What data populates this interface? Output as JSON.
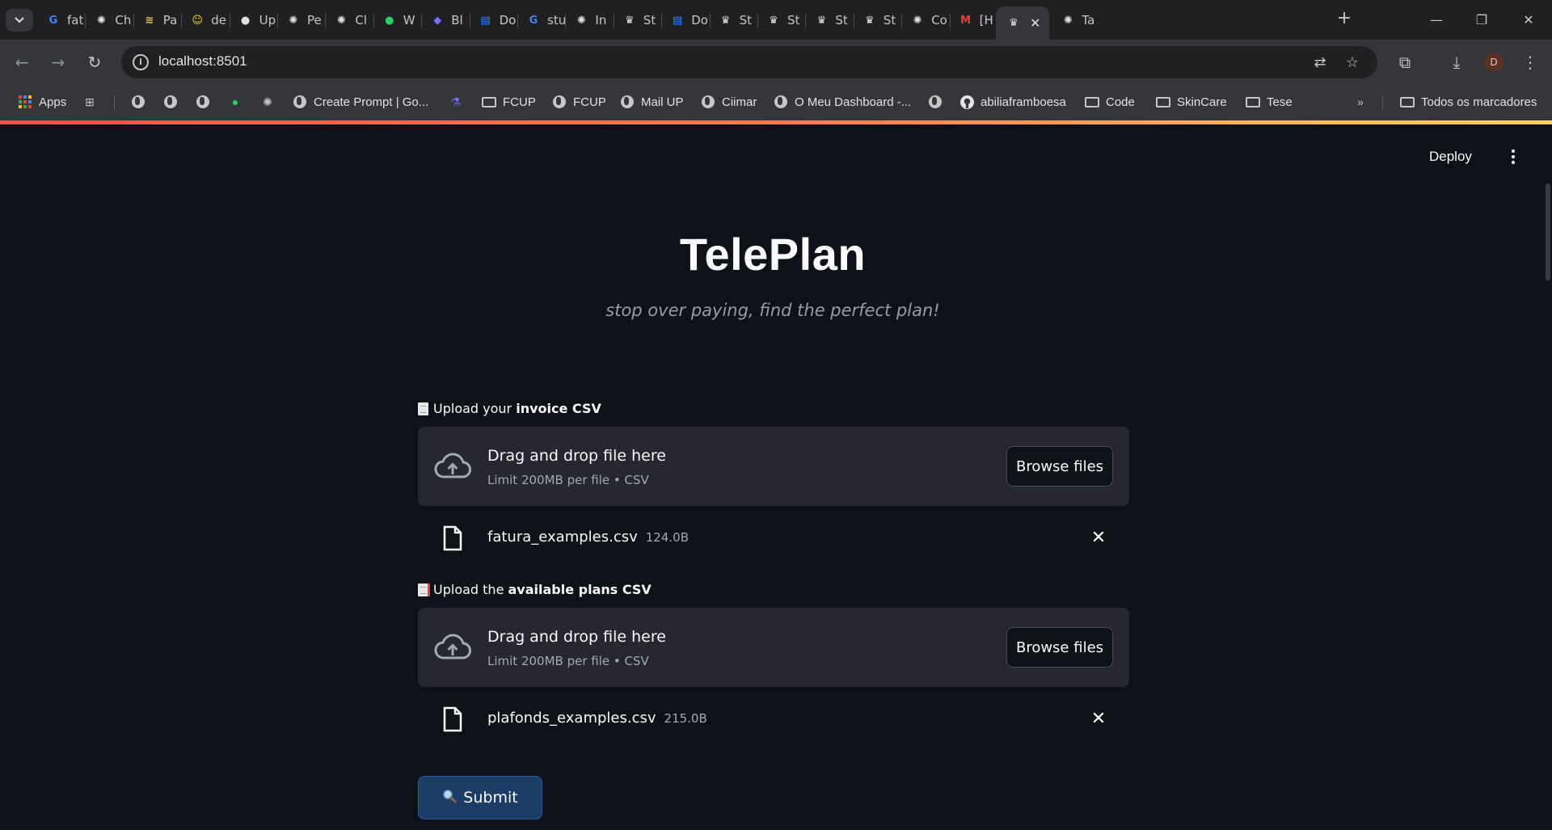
{
  "browser": {
    "tabs": [
      {
        "title": "fat",
        "icon": "google-icon"
      },
      {
        "title": "Ch",
        "icon": "openai-icon"
      },
      {
        "title": "Pa",
        "icon": "papers-icon"
      },
      {
        "title": "de",
        "icon": "huggingface-icon"
      },
      {
        "title": "Up",
        "icon": "github-icon"
      },
      {
        "title": "Pe",
        "icon": "openai-icon"
      },
      {
        "title": "Cl",
        "icon": "openai-icon"
      },
      {
        "title": "W",
        "icon": "whatsapp-icon"
      },
      {
        "title": "Bl",
        "icon": "shield-icon"
      },
      {
        "title": "Do",
        "icon": "docs-icon"
      },
      {
        "title": "stu",
        "icon": "google-icon"
      },
      {
        "title": "In",
        "icon": "openai-icon"
      },
      {
        "title": "St",
        "icon": "streamlit-icon"
      },
      {
        "title": "Do",
        "icon": "docs-icon"
      },
      {
        "title": "St",
        "icon": "streamlit-icon"
      },
      {
        "title": "St",
        "icon": "streamlit-icon"
      },
      {
        "title": "St",
        "icon": "streamlit-icon"
      },
      {
        "title": "St",
        "icon": "streamlit-icon"
      },
      {
        "title": "Co",
        "icon": "openai-icon"
      },
      {
        "title": "[H",
        "icon": "gmail-icon"
      },
      {
        "title": "",
        "icon": "streamlit-icon",
        "active": true
      },
      {
        "title": "Ta",
        "icon": "openai-icon"
      }
    ],
    "url": "localhost:8501",
    "avatar_letter": "D",
    "bookmarks": {
      "apps": "Apps",
      "create_prompt": "Create Prompt | Go...",
      "fcup_folder": "FCUP",
      "fcup": "FCUP",
      "mail_up": "Mail UP",
      "ciimar": "Ciimar",
      "dashboard": "O Meu Dashboard -...",
      "abilia": "abiliaframboesa",
      "code": "Code",
      "skincare": "SkinCare",
      "tese": "Tese",
      "all_bookmarks": "Todos os marcadores"
    }
  },
  "app": {
    "deploy_label": "Deploy",
    "title": "TelePlan",
    "subtitle": "stop over paying, find the perfect plan!",
    "invoice_upload": {
      "label_prefix": "Upload your ",
      "label_bold": "invoice CSV",
      "drop_title": "Drag and drop file here",
      "drop_limit": "Limit 200MB per file • CSV",
      "browse_label": "Browse files",
      "file_name": "fatura_examples.csv",
      "file_size": "124.0B"
    },
    "plans_upload": {
      "label_prefix": "Upload the ",
      "label_bold": "available plans CSV",
      "drop_title": "Drag and drop file here",
      "drop_limit": "Limit 200MB per file • CSV",
      "browse_label": "Browse files",
      "file_name": "plafonds_examples.csv",
      "file_size": "215.0B"
    },
    "submit_label": "Submit",
    "colors": {
      "background": "#0e1117",
      "dropzone": "#262730",
      "submit": "#1b3d66",
      "accent_gradient_start": "#ff4b4b"
    }
  }
}
